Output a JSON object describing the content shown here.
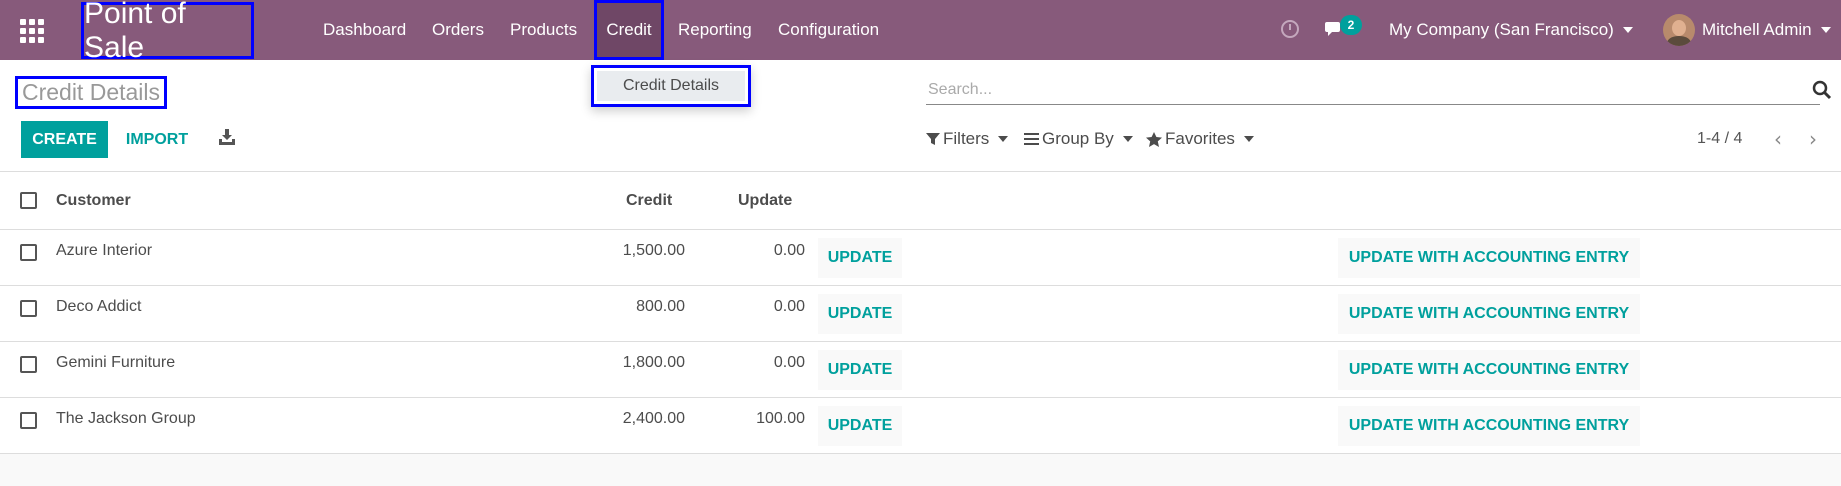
{
  "navbar": {
    "app_title": "Point of Sale",
    "menu": [
      {
        "label": "Dashboard"
      },
      {
        "label": "Orders"
      },
      {
        "label": "Products"
      },
      {
        "label": "Credit"
      },
      {
        "label": "Reporting"
      },
      {
        "label": "Configuration"
      }
    ],
    "active_menu": "Credit",
    "messages_badge": "2",
    "company": "My Company (San Francisco)",
    "user": "Mitchell Admin",
    "color": "#875a7b"
  },
  "dropdown": {
    "item": "Credit Details"
  },
  "control_panel": {
    "title": "Credit Details",
    "search_placeholder": "Search...",
    "create_label": "CREATE",
    "import_label": "IMPORT",
    "filters_label": "Filters",
    "group_by_label": "Group By",
    "favorites_label": "Favorites",
    "pager": "1-4 / 4",
    "accent": "#00a09d"
  },
  "table": {
    "columns": {
      "customer": "Customer",
      "credit": "Credit",
      "update": "Update"
    },
    "rows": [
      {
        "customer": "Azure Interior",
        "credit": "1,500.00",
        "update": "0.00",
        "btn_update": "UPDATE",
        "btn_accounting": "UPDATE WITH ACCOUNTING ENTRY"
      },
      {
        "customer": "Deco Addict",
        "credit": "800.00",
        "update": "0.00",
        "btn_update": "UPDATE",
        "btn_accounting": "UPDATE WITH ACCOUNTING ENTRY"
      },
      {
        "customer": "Gemini Furniture",
        "credit": "1,800.00",
        "update": "0.00",
        "btn_update": "UPDATE",
        "btn_accounting": "UPDATE WITH ACCOUNTING ENTRY"
      },
      {
        "customer": "The Jackson Group",
        "credit": "2,400.00",
        "update": "100.00",
        "btn_update": "UPDATE",
        "btn_accounting": "UPDATE WITH ACCOUNTING ENTRY"
      }
    ]
  }
}
